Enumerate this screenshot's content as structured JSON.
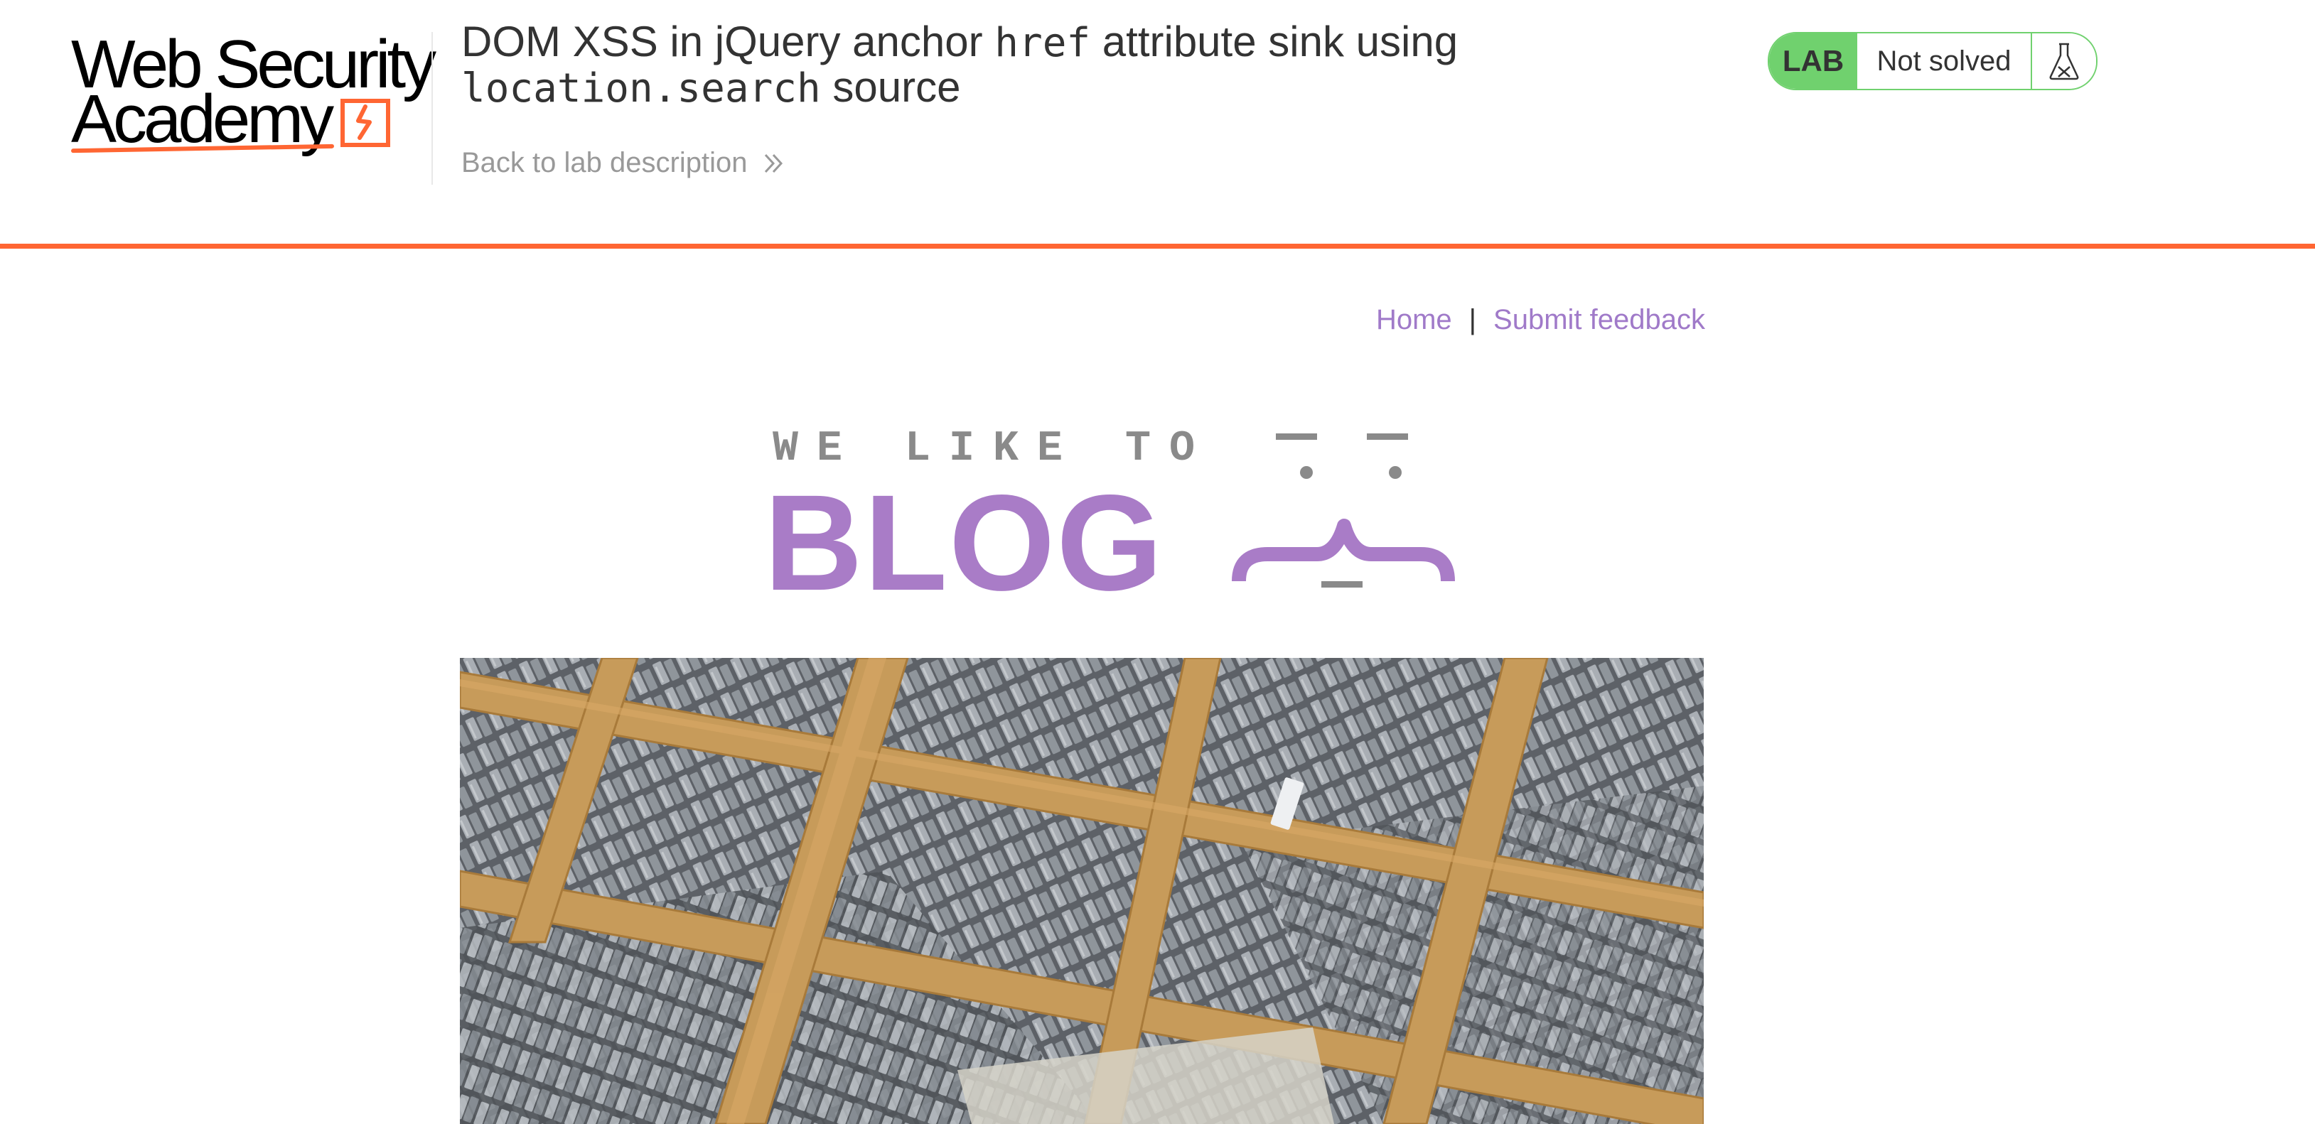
{
  "header": {
    "logo": {
      "line1": "Web Security",
      "line2": "Academy"
    },
    "lab_title": {
      "part1": "DOM XSS in jQuery anchor ",
      "code1": "href",
      "part2": " attribute sink using",
      "code2": "location.search",
      "part3": " source"
    },
    "back_link": "Back to lab description",
    "status": {
      "badge": "LAB",
      "state": "Not solved",
      "icon": "flask-icon"
    }
  },
  "nav": {
    "home": "Home",
    "separator": "|",
    "feedback": "Submit feedback"
  },
  "banner": {
    "tagline": "WE LIKE TO",
    "title": "BLOG"
  },
  "colors": {
    "accent": "#ff6633",
    "lab_green": "#70d16e",
    "link_purple": "#a07ac9",
    "blog_purple": "#a97cc7"
  }
}
